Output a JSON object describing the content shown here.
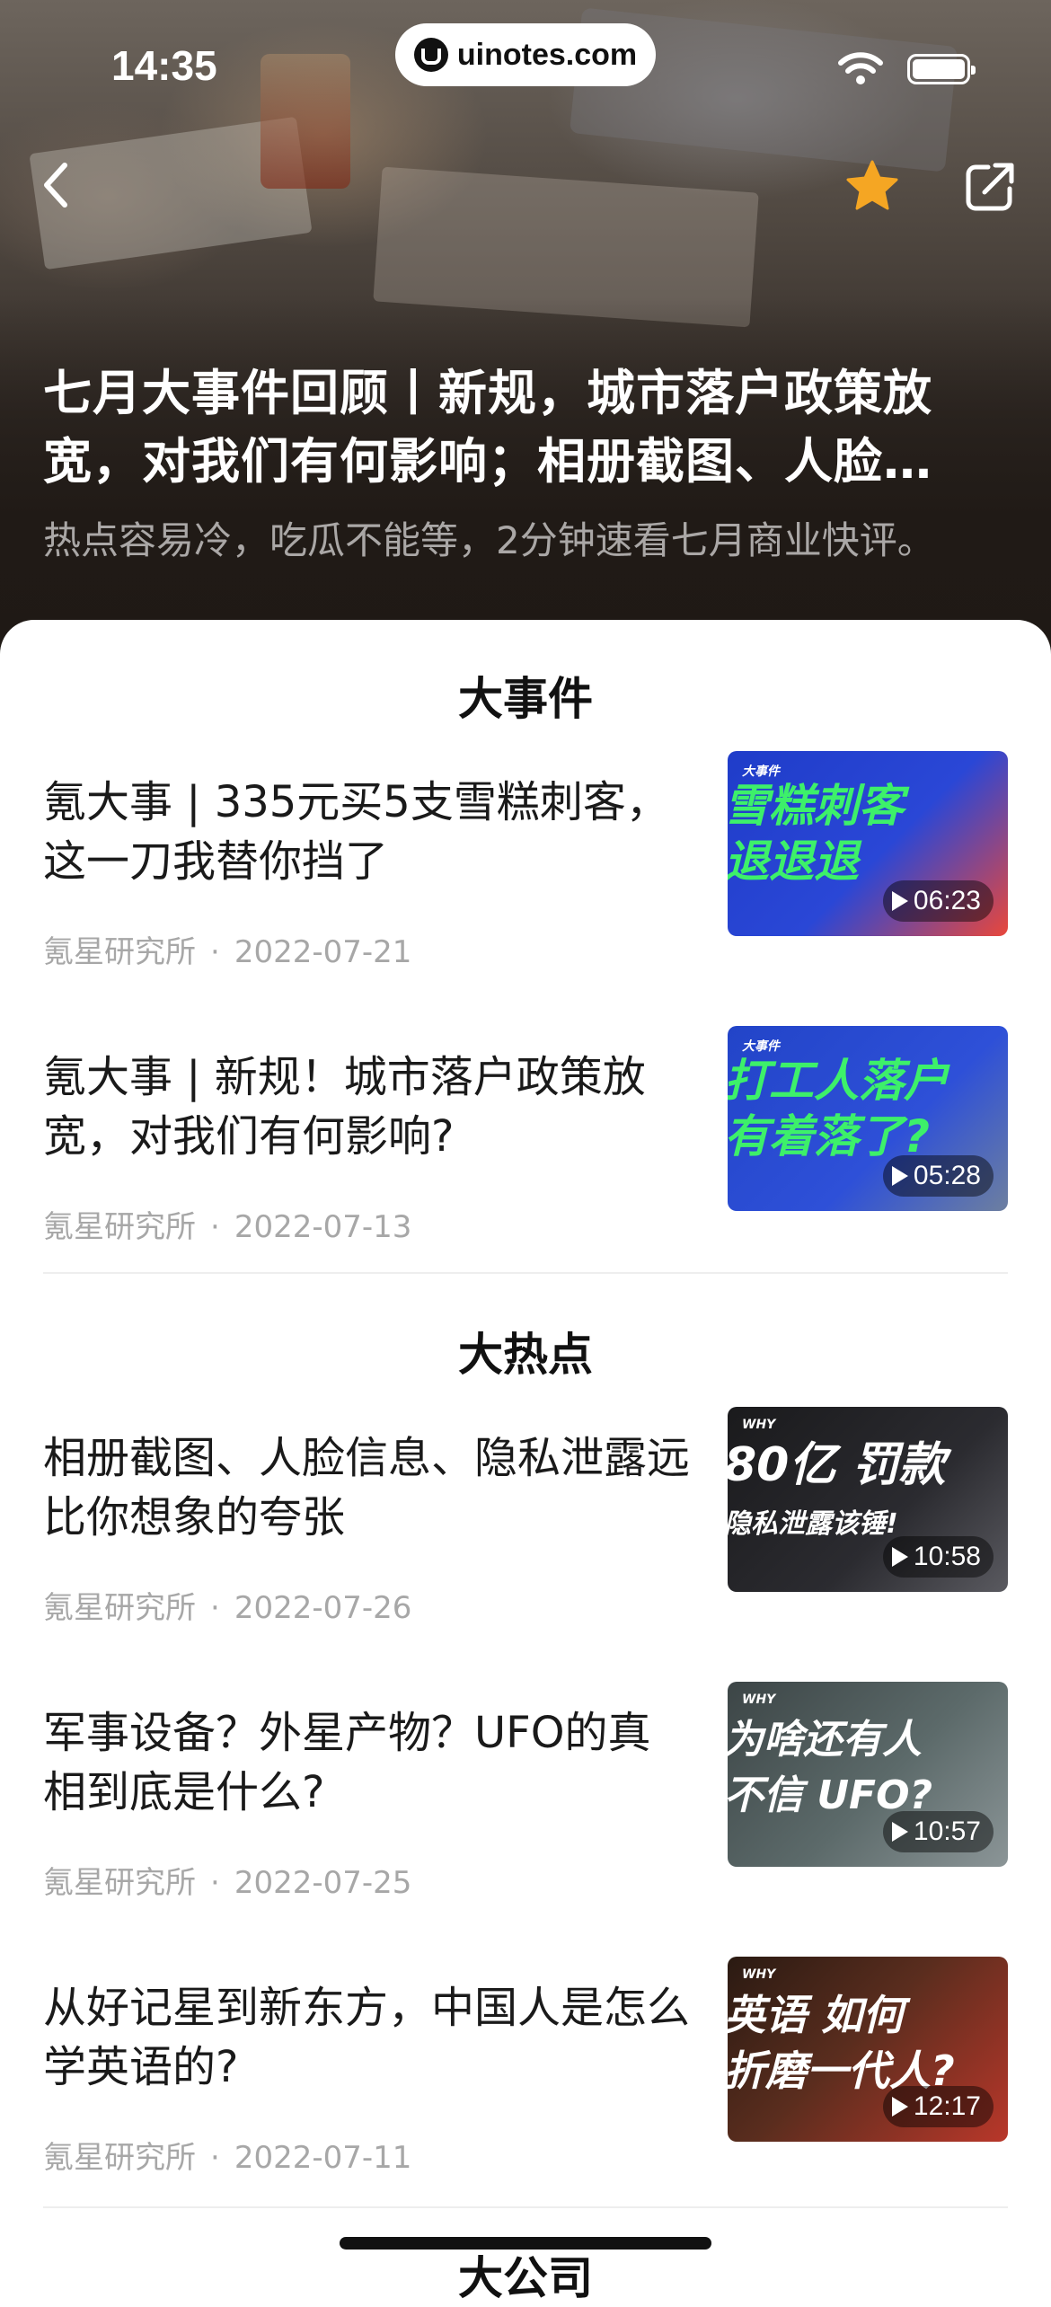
{
  "status_bar": {
    "time": "14:35",
    "url": "uinotes.com"
  },
  "header": {
    "title": "七月大事件回顾丨新规，城市落户政策放宽，对我们有何影响；相册截图、人脸…",
    "subtitle": "热点容易冷，吃瓜不能等，2分钟速看七月商业快评。",
    "icons": [
      "back-icon",
      "star-icon",
      "share-icon"
    ],
    "star_color": "#F5A623"
  },
  "sections": [
    {
      "title": "大事件",
      "items": [
        {
          "title": "氪大事 | 335元买5支雪糕刺客，这一刀我替你挡了",
          "author": "氪星研究所",
          "date": "2022-07-21",
          "duration": "06:23",
          "thumb_tag": "大事件",
          "thumb_text": [
            "雪糕刺客",
            "退退退"
          ]
        },
        {
          "title": "氪大事 | 新规！城市落户政策放宽，对我们有何影响?",
          "author": "氪星研究所",
          "date": "2022-07-13",
          "duration": "05:28",
          "thumb_tag": "大事件",
          "thumb_text": [
            "打工人落户",
            "有着落了?"
          ]
        }
      ]
    },
    {
      "title": "大热点",
      "items": [
        {
          "title": "相册截图、人脸信息、隐私泄露远比你想象的夸张",
          "author": "氪星研究所",
          "date": "2022-07-26",
          "duration": "10:58",
          "thumb_tag": "WHY",
          "thumb_text": [
            "80亿 罚款",
            "隐私泄露该锤!"
          ]
        },
        {
          "title": "军事设备？外星产物？UFO的真相到底是什么?",
          "author": "氪星研究所",
          "date": "2022-07-25",
          "duration": "10:57",
          "thumb_tag": "WHY",
          "thumb_text": [
            "为啥还有人",
            "不信 UFO?"
          ]
        },
        {
          "title": "从好记星到新东方，中国人是怎么学英语的?",
          "author": "氪星研究所",
          "date": "2022-07-11",
          "duration": "12:17",
          "thumb_tag": "WHY",
          "thumb_text": [
            "英语 如何",
            "折磨一代人?"
          ]
        }
      ]
    },
    {
      "title": "大公司"
    }
  ]
}
